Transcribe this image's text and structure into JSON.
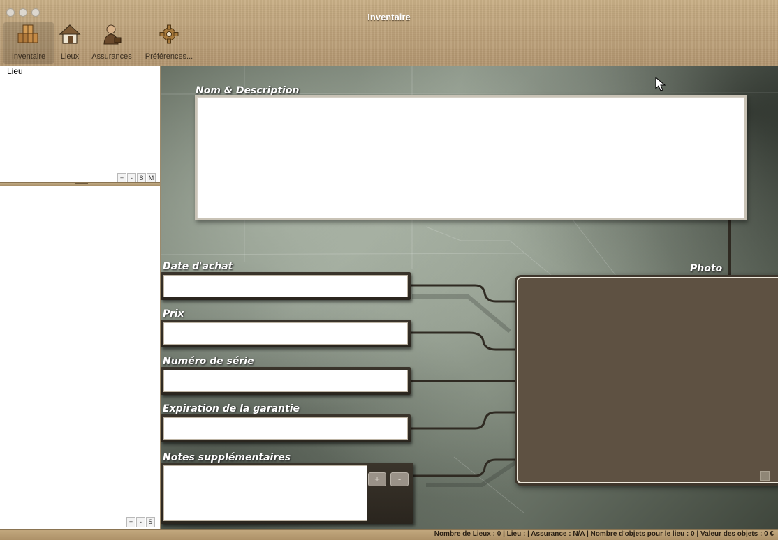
{
  "window": {
    "title": "Inventaire"
  },
  "toolbar": {
    "items": [
      {
        "label": "Inventaire",
        "icon": "boxes-icon"
      },
      {
        "label": "Lieux",
        "icon": "house-icon"
      },
      {
        "label": "Assurances",
        "icon": "agent-icon"
      },
      {
        "label": "Préférences...",
        "icon": "gear-icon"
      }
    ]
  },
  "sidebar": {
    "header": "Lieu",
    "top_buttons": [
      "+",
      "-",
      "S",
      "M"
    ],
    "bottom_buttons": [
      "+",
      "-",
      "S"
    ]
  },
  "form": {
    "name_label": "Nom & Description",
    "purchase_date_label": "Date d'achat",
    "price_label": "Prix",
    "serial_label": "Numéro de série",
    "warranty_label": "Expiration de la garantie",
    "notes_label": "Notes supplémentaires",
    "photo_label": "Photo",
    "notes_buttons": [
      "+",
      "-"
    ]
  },
  "statusbar": {
    "text": "Nombre de Lieux : 0 | Lieu :  | Assurance : N/A | Nombre d'objets pour le lieu : 0 | Valeur des objets : 0 €"
  },
  "colors": {
    "chrome": "#b99f77",
    "frame_dark": "#2f2a22",
    "photo_bg": "#5e5142",
    "label_text": "#ffffff"
  }
}
